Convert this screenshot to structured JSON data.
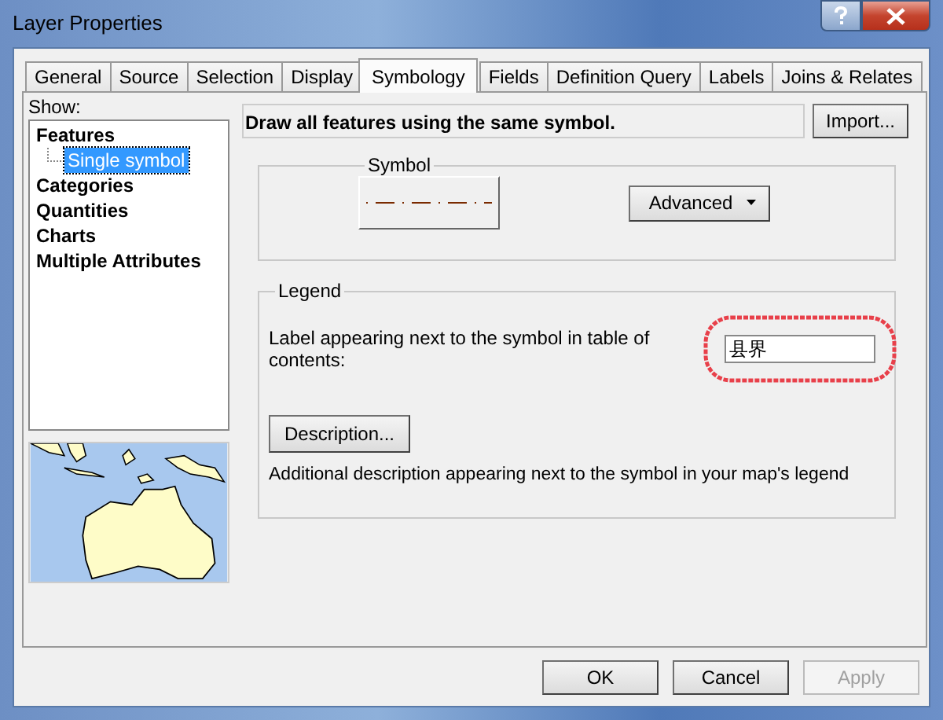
{
  "window": {
    "title": "Layer Properties"
  },
  "tabs": [
    {
      "label": "General",
      "selected": false
    },
    {
      "label": "Source",
      "selected": false
    },
    {
      "label": "Selection",
      "selected": false
    },
    {
      "label": "Display",
      "selected": false
    },
    {
      "label": "Symbology",
      "selected": true
    },
    {
      "label": "Fields",
      "selected": false
    },
    {
      "label": "Definition Query",
      "selected": false
    },
    {
      "label": "Labels",
      "selected": false
    },
    {
      "label": "Joins & Relates",
      "selected": false
    }
  ],
  "show": {
    "label": "Show:",
    "items": [
      {
        "label": "Features",
        "selected": false,
        "children": [
          {
            "label": "Single symbol",
            "selected": true
          }
        ]
      },
      {
        "label": "Categories",
        "selected": false
      },
      {
        "label": "Quantities",
        "selected": false
      },
      {
        "label": "Charts",
        "selected": false
      },
      {
        "label": "Multiple Attributes",
        "selected": false
      }
    ]
  },
  "header": {
    "text": "Draw all features using the same symbol.",
    "import_button": "Import..."
  },
  "symbol_group": {
    "title": "Symbol",
    "advanced_button": "Advanced"
  },
  "legend_group": {
    "title": "Legend",
    "label_text": "Label appearing next to the symbol in table of contents:",
    "label_value": "县界",
    "highlighted": true,
    "description_button": "Description...",
    "description_text": "Additional description appearing next to the symbol in your map's legend"
  },
  "buttons": [
    {
      "label": "OK",
      "disabled": false
    },
    {
      "label": "Cancel",
      "disabled": false
    },
    {
      "label": "Apply",
      "disabled": true
    }
  ]
}
